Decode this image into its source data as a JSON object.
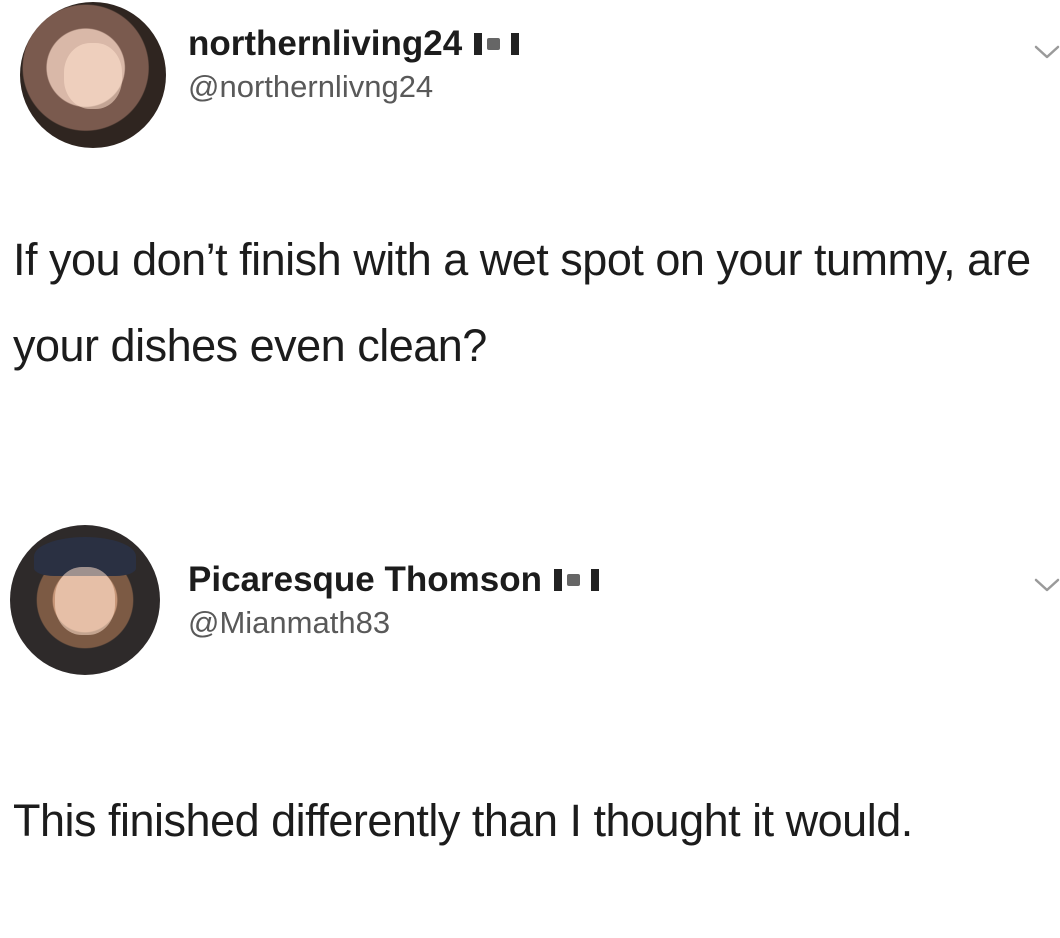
{
  "tweets": [
    {
      "display_name": "northernliving24",
      "flag_icon": "canada-flag-icon",
      "handle": "@northernlivng24",
      "text": "If you don’t finish with a wet spot on your tummy, are your dishes even clean?"
    },
    {
      "display_name": "Picaresque Thomson",
      "flag_icon": "canada-flag-icon",
      "handle": "@Mianmath83",
      "text": "This finished differently than I thought it would."
    }
  ],
  "icons": {
    "menu": "chevron-down-icon"
  },
  "colors": {
    "text": "#1c1c1c",
    "handle": "#595959",
    "background": "#ffffff"
  }
}
